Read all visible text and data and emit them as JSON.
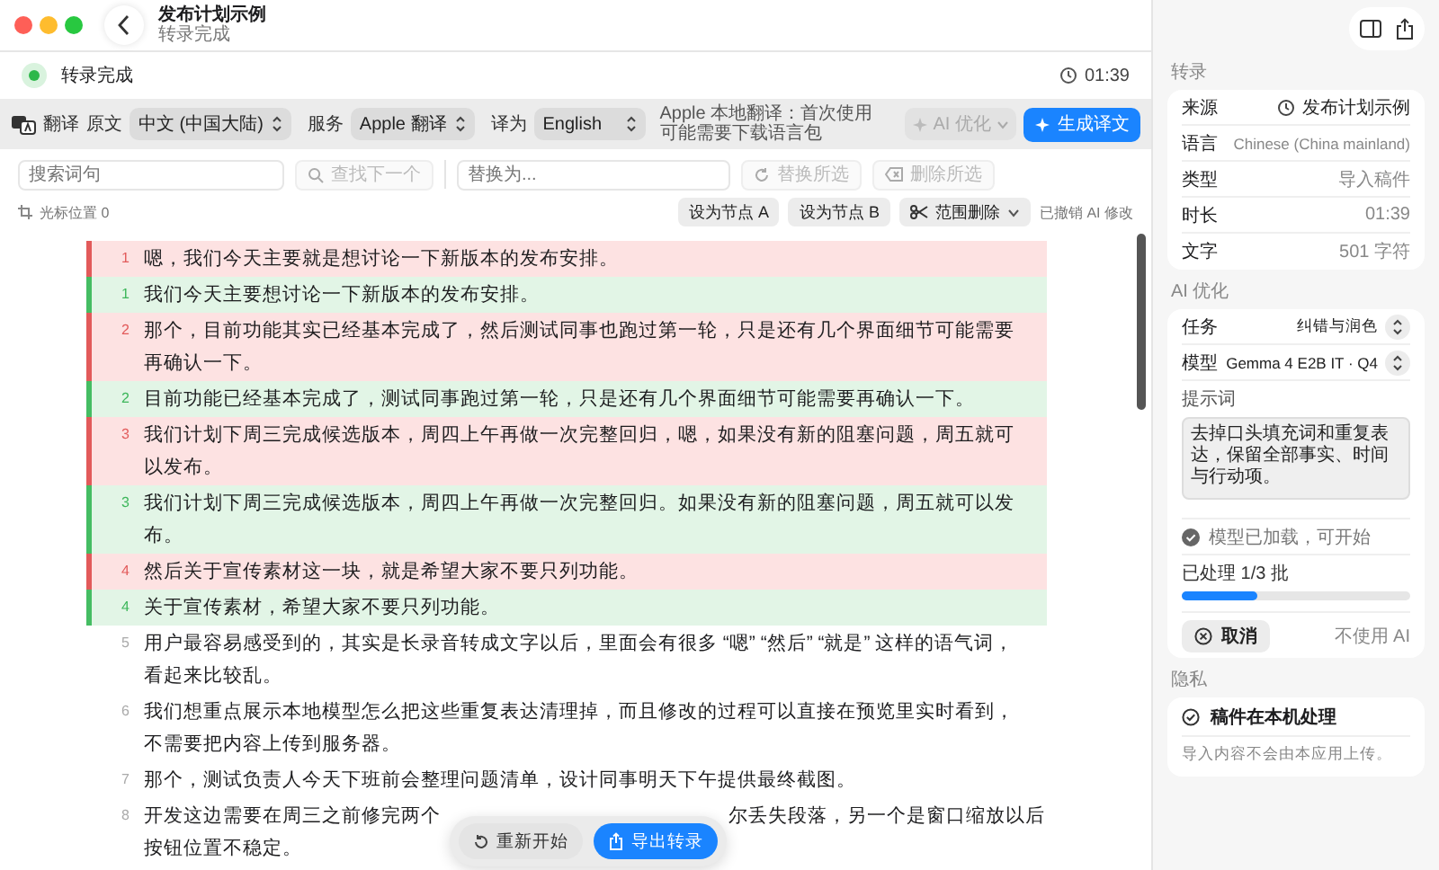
{
  "window": {
    "title": "发布计划示例",
    "subtitle": "转录完成"
  },
  "status": {
    "label": "转录完成",
    "done": true,
    "time": "01:39"
  },
  "toolbar": {
    "translate_label": "翻译",
    "source_label": "原文",
    "source": "中文 (中国大陆)",
    "service_label": "服务",
    "service": "Apple 翻译",
    "target_label": "译为",
    "target": "English",
    "note": "Apple 本地翻译：首次使用可能需要下载语言包",
    "ai_button": {
      "label": "AI 优化",
      "disabled": true
    },
    "generate_button": "生成译文"
  },
  "search": {
    "placeholder": "搜索词句",
    "find_next": {
      "label": "查找下一个",
      "disabled": true
    },
    "replace_placeholder": "替换为...",
    "replace_selected": {
      "label": "替换所选",
      "disabled": true
    },
    "delete_selected": {
      "label": "删除所选",
      "disabled": true
    }
  },
  "edit_bar": {
    "cursor": "光标位置 0",
    "set_a": "设为节点 A",
    "set_b": "设为节点 B",
    "range_delete": "范围删除",
    "status": "已撤销 AI 修改"
  },
  "lines": [
    {
      "number": "1",
      "kind": "removed",
      "parts": [
        "嗯，我们今天主要就是想讨论一下新版本的发布安排。"
      ]
    },
    {
      "number": "1",
      "kind": "added",
      "parts": [
        "我们今天主要想讨论一下新版本的发布安排。"
      ]
    },
    {
      "number": "2",
      "kind": "removed",
      "parts": [
        "那个，目前功能其实已经基本完成了，然后测试同事也跑过第一轮，只是还有几个界面细节可能需要再确认一下。"
      ]
    },
    {
      "number": "2",
      "kind": "added",
      "parts": [
        "目前功能已经基本完成了，测试同事跑过第一轮，只是还有几个界面细节可能需要再确认一下。"
      ]
    },
    {
      "number": "3",
      "kind": "removed",
      "parts": [
        "我们计划下周三完成候选版本，周四上午再做一次完整回归，嗯，如果没有新的阻塞问题，周五就可以发布。"
      ]
    },
    {
      "number": "3",
      "kind": "added",
      "parts": [
        "我们计划下周三完成候选版本，周四上午再做一次完整回归。如果没有新的阻塞问题，周五就可以发布。"
      ]
    },
    {
      "number": "4",
      "kind": "removed",
      "parts": [
        "然后关于宣传素材这一块，就是希望大家不要只列功能。"
      ]
    },
    {
      "number": "4",
      "kind": "added",
      "parts": [
        "关于宣传素材，希望大家不要只列功能。"
      ]
    },
    {
      "number": "5",
      "kind": "plain",
      "parts": [
        "用户最容易感受到的，其实是长录音转成文字以后，里面会有很多 “嗯” “然后” “就是” 这样的语气词，看起来比较乱。"
      ]
    },
    {
      "number": "6",
      "kind": "plain",
      "parts": [
        "我们想重点展示本地模型怎么把这些重复表达清理掉，而且修改的过程可以直接在预览里实时看到，不需要把内容上传到服务器。"
      ]
    },
    {
      "number": "7",
      "kind": "plain",
      "parts": [
        "那个，测试负责人今天下班前会整理问题清单，设计同事明天下午提供最终截图。"
      ]
    },
    {
      "number": "8",
      "kind": "plain",
      "parts": [
        "开发这边需要在周三之前修完两个",
        "尔丢失段落，另一个是窗口缩放以后",
        "按钮位置不稳定。"
      ]
    }
  ],
  "float_bar": {
    "restart": "重新开始",
    "export": "导出转录"
  },
  "inspector": {
    "transcript_title": "转录",
    "info": [
      {
        "label": "来源",
        "value": "发布计划示例",
        "kind": "source"
      },
      {
        "label": "语言",
        "value": "Chinese (China mainland)",
        "kind": "plain"
      },
      {
        "label": "类型",
        "value": "导入稿件",
        "kind": "plain"
      },
      {
        "label": "时长",
        "value": "01:39",
        "kind": "plain"
      },
      {
        "label": "文字",
        "value": "501 字符",
        "kind": "plain"
      }
    ],
    "ai_title": "AI 优化",
    "task": {
      "label": "任务",
      "value": "纠错与润色"
    },
    "model": {
      "label": "模型",
      "value": "Gemma 4 E2B IT · Q4"
    },
    "prompt_label": "提示词",
    "prompt": "去掉口头填充词和重复表达，保留全部事实、时间与行动项。",
    "model_status": "模型已加载，可开始",
    "progress_label": "已处理 1/3 批",
    "progress": {
      "level": 0.33
    },
    "cancel": "取消",
    "skip_ai": "不使用 AI",
    "privacy_title": "隐私",
    "privacy_item": "稿件在本机处理",
    "privacy_note": "导入内容不会由本应用上传。"
  }
}
